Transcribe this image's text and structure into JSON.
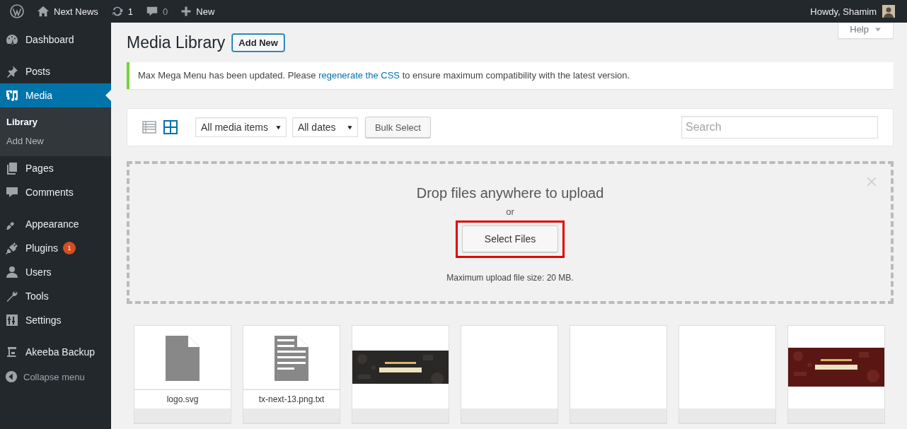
{
  "admin_bar": {
    "site_name": "Next News",
    "updates_count": "1",
    "comments_count": "0",
    "new_label": "New",
    "greeting": "Howdy, Shamim"
  },
  "sidebar": {
    "items": [
      {
        "label": "Dashboard",
        "selected": false
      },
      {
        "label": "Posts",
        "selected": false
      },
      {
        "label": "Media",
        "selected": true,
        "children": [
          {
            "label": "Library",
            "selected": true
          },
          {
            "label": "Add New",
            "selected": false
          }
        ]
      },
      {
        "label": "Pages",
        "selected": false
      },
      {
        "label": "Comments",
        "selected": false
      },
      {
        "label": "Appearance",
        "selected": false
      },
      {
        "label": "Plugins",
        "selected": false,
        "badge": "1"
      },
      {
        "label": "Users",
        "selected": false
      },
      {
        "label": "Tools",
        "selected": false
      },
      {
        "label": "Settings",
        "selected": false
      },
      {
        "label": "Akeeba Backup",
        "selected": false
      }
    ],
    "collapse_label": "Collapse menu"
  },
  "help_tab": {
    "label": "Help"
  },
  "page": {
    "title": "Media Library",
    "add_new_button": "Add New"
  },
  "notice": {
    "text_before": "Max Mega Menu has been updated. Please ",
    "link": "regenerate the CSS",
    "text_after": " to ensure maximum compatibility with the latest version."
  },
  "toolbar": {
    "view_modes": [
      {
        "kind": "list",
        "selected": false
      },
      {
        "kind": "grid",
        "selected": true
      }
    ],
    "filters": [
      {
        "label": "All media items"
      },
      {
        "label": "All dates"
      }
    ],
    "bulk_button": "Bulk Select",
    "search": {
      "placeholder": "Search"
    }
  },
  "uploader": {
    "heading": "Drop files anywhere to upload",
    "or": "or",
    "button": "Select Files",
    "highlighted": true,
    "max_size": "Maximum upload file size: 20 MB."
  },
  "attachments": [
    {
      "kind": "file",
      "filename": "logo.svg"
    },
    {
      "kind": "text-file",
      "filename": "tx-next-13.png.txt"
    },
    {
      "kind": "picture"
    },
    {
      "kind": "blank"
    },
    {
      "kind": "blank"
    },
    {
      "kind": "blank"
    },
    {
      "kind": "picture"
    }
  ]
}
